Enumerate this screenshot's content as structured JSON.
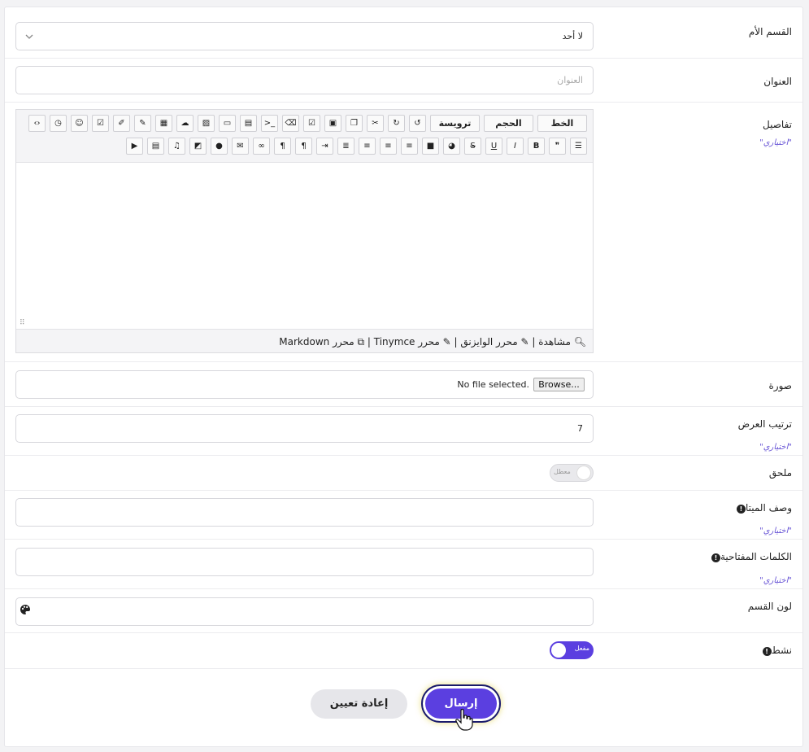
{
  "form": {
    "parent": {
      "label": "القسم الأم",
      "value": "لا أحد"
    },
    "title": {
      "label": "العنوان",
      "placeholder": "العنوان"
    },
    "details": {
      "label": "تفاصيل",
      "optional": "اختياري",
      "toolbar": {
        "font_label": "الخط",
        "size_label": "الحجم",
        "heading_label": "ترويسة",
        "row1_icons": [
          "undo-icon",
          "redo-icon",
          "cut-icon",
          "copy-icon",
          "paste-icon",
          "select-all-icon",
          "eraser-icon",
          "code-icon",
          "document-icon",
          "frame-icon",
          "image-icon",
          "upload-icon",
          "archive-icon",
          "link-edit-icon",
          "note-icon",
          "checkbox-icon",
          "emoji-icon",
          "history-icon",
          "source-icon"
        ],
        "row2_icons": [
          "list-icon",
          "quote-icon",
          "bold-icon",
          "italic-icon",
          "underline-icon",
          "strike-icon",
          "palette-icon",
          "block-icon",
          "align-right-icon",
          "align-center-icon",
          "align-left-icon",
          "justify-icon",
          "indent-icon",
          "rtl-icon",
          "ltr-icon",
          "link-icon",
          "email-icon",
          "comment-icon",
          "embed-icon",
          "music-icon",
          "video-icon",
          "youtube-icon"
        ]
      },
      "footer": {
        "preview": "مشاهدة",
        "wysiwyg": "محرر الوايزنق",
        "tinymce": "محرر Tinymce",
        "markdown": "محرر Markdown"
      }
    },
    "image": {
      "label": "صورة",
      "browse": "Browse...",
      "status": "No file selected."
    },
    "order": {
      "label": "ترتيب العرض",
      "value": "7",
      "optional": "اختياري"
    },
    "attached": {
      "label": "ملحق",
      "state": "معطل"
    },
    "meta_desc": {
      "label": "وصف الميتا",
      "optional": "اختياري"
    },
    "keywords": {
      "label": "الكلمات المفتاحية",
      "optional": "اختياري"
    },
    "color": {
      "label": "لون القسم"
    },
    "active": {
      "label": "نشط",
      "state": "مفعل"
    }
  },
  "actions": {
    "submit": "إرسال",
    "reset": "إعادة تعيين"
  },
  "colors": {
    "accent": "#5b3fe0",
    "optional": "#6a57d6"
  }
}
